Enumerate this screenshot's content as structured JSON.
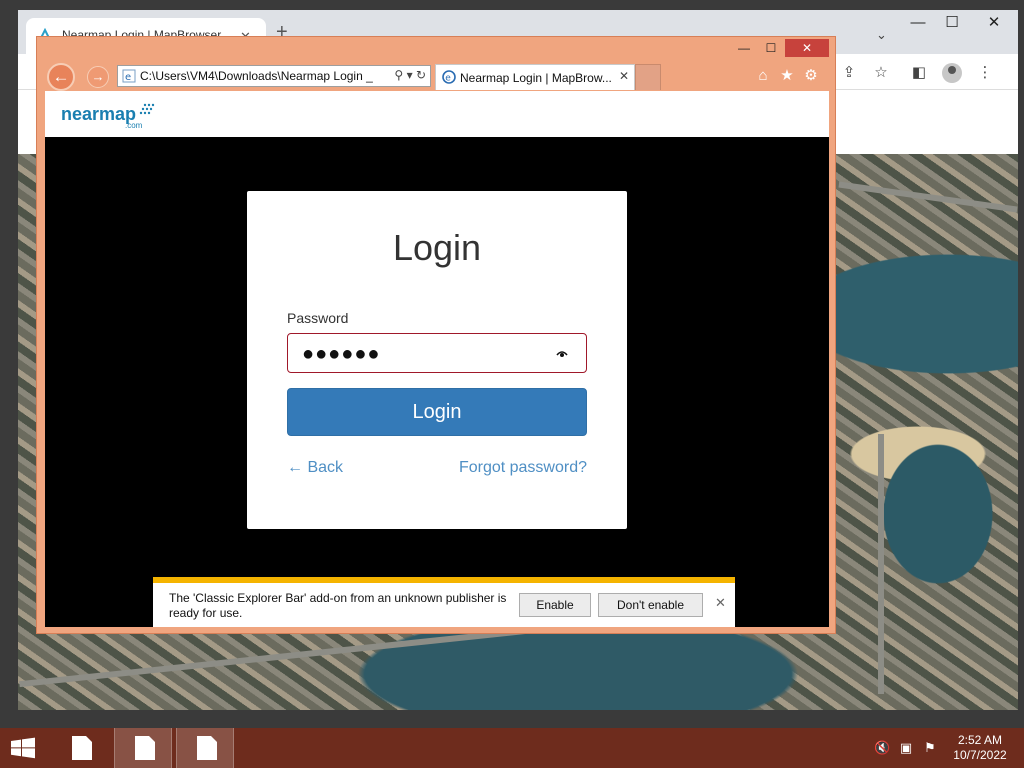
{
  "colors": {
    "ie_frame": "#f0a57f",
    "taskbar": "#6e2c1d",
    "login_button": "#347ab8",
    "link": "#4f8fc4",
    "field_border": "#a0182a",
    "notification_accent": "#f5b400",
    "ie_close": "#c7423c"
  },
  "chrome": {
    "tab_title": "Nearmap Login | MapBrowser",
    "icons": [
      "new-tab-icon",
      "tab-search-icon",
      "share-icon",
      "bookmark-star-icon",
      "side-panel-icon",
      "profile-icon",
      "menu-icon"
    ]
  },
  "ie": {
    "address": "C:\\Users\\VM4\\Downloads\\Nearmap Login _",
    "tab_title": "Nearmap Login | MapBrow...",
    "icons": [
      "back-icon",
      "forward-icon",
      "search-icon",
      "refresh-icon",
      "home-icon",
      "favorites-star-icon",
      "settings-gear-icon"
    ]
  },
  "page": {
    "logo_text": "nearmap",
    "logo_sub": ".com",
    "login": {
      "title": "Login",
      "password_label": "Password",
      "password_value": "●●●●●●",
      "submit_label": "Login",
      "back_label": "← Back",
      "forgot_label": "Forgot password?"
    }
  },
  "notification": {
    "message": "The 'Classic Explorer Bar' add-on from an unknown publisher is ready for use.",
    "enable_label": "Enable",
    "dont_enable_label": "Don't enable"
  },
  "taskbar": {
    "time": "2:52 AM",
    "date": "10/7/2022"
  }
}
